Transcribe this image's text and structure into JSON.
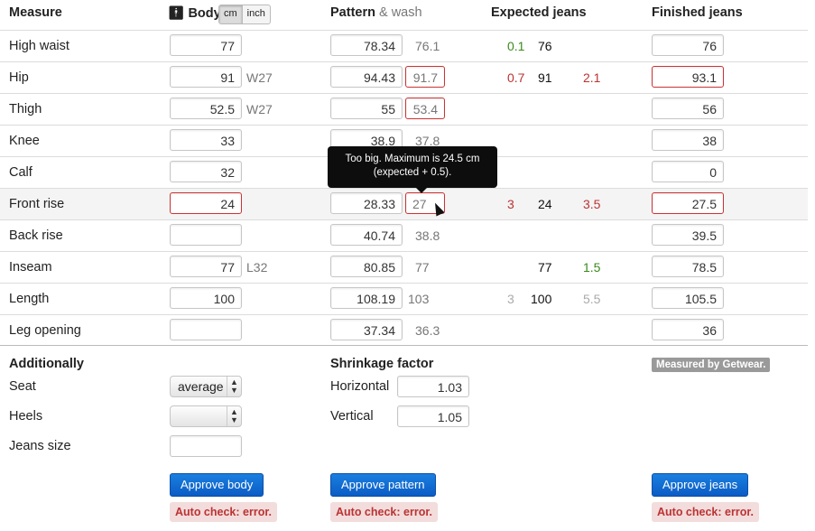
{
  "headers": {
    "measure": "Measure",
    "body": "Body",
    "unit_cm": "cm",
    "unit_inch": "inch",
    "pattern": "Pattern",
    "pattern_suffix": "& wash",
    "expected": "Expected jeans",
    "finished": "Finished jeans"
  },
  "rows": [
    {
      "label": "High waist",
      "body": "77",
      "body_note": "",
      "pattern": "78.34",
      "pattern_calc": "76.1",
      "exp_a": "0.1",
      "exp_b": "76",
      "exp_c": "",
      "finished": "76"
    },
    {
      "label": "Hip",
      "body": "91",
      "body_note": "W27",
      "pattern": "94.43",
      "pattern_calc": "91.7",
      "exp_a": "0.7",
      "exp_b": "91",
      "exp_c": "2.1",
      "finished": "93.1"
    },
    {
      "label": "Thigh",
      "body": "52.5",
      "body_note": "W27",
      "pattern": "55",
      "pattern_calc": "53.4",
      "exp_a": "",
      "exp_b": "",
      "exp_c": "",
      "finished": "56"
    },
    {
      "label": "Knee",
      "body": "33",
      "body_note": "",
      "pattern": "38.9",
      "pattern_calc": "37.8",
      "exp_a": "",
      "exp_b": "",
      "exp_c": "",
      "finished": "38"
    },
    {
      "label": "Calf",
      "body": "32",
      "body_note": "",
      "pattern": "",
      "pattern_calc": "",
      "exp_a": "",
      "exp_b": "",
      "exp_c": "",
      "finished": "0"
    },
    {
      "label": "Front rise",
      "body": "24",
      "body_note": "",
      "pattern": "28.33",
      "pattern_calc": "27",
      "exp_a": "3",
      "exp_b": "24",
      "exp_c": "3.5",
      "finished": "27.5"
    },
    {
      "label": "Back rise",
      "body": "",
      "body_note": "",
      "pattern": "40.74",
      "pattern_calc": "38.8",
      "exp_a": "",
      "exp_b": "",
      "exp_c": "",
      "finished": "39.5"
    },
    {
      "label": "Inseam",
      "body": "77",
      "body_note": "L32",
      "pattern": "80.85",
      "pattern_calc": "77",
      "exp_a": "",
      "exp_b": "77",
      "exp_c": "1.5",
      "finished": "78.5"
    },
    {
      "label": "Length",
      "body": "100",
      "body_note": "",
      "pattern": "108.19",
      "pattern_calc": "103",
      "exp_a": "3",
      "exp_b": "100",
      "exp_c": "5.5",
      "finished": "105.5"
    },
    {
      "label": "Leg opening",
      "body": "",
      "body_note": "",
      "pattern": "37.34",
      "pattern_calc": "36.3",
      "exp_a": "",
      "exp_b": "",
      "exp_c": "",
      "finished": "36"
    }
  ],
  "tooltip": "Too big. Maximum is 24.5 cm (expected + 0.5).",
  "additionally": {
    "title": "Additionally",
    "seat_label": "Seat",
    "seat_value": "average",
    "heels_label": "Heels",
    "heels_value": "",
    "jeans_size_label": "Jeans size",
    "jeans_size_value": ""
  },
  "shrinkage": {
    "title": "Shrinkage factor",
    "horizontal_label": "Horizontal",
    "horizontal_value": "1.03",
    "vertical_label": "Vertical",
    "vertical_value": "1.05"
  },
  "badge": "Measured by Getwear.",
  "buttons": {
    "approve_body": "Approve body",
    "approve_pattern": "Approve pattern",
    "approve_jeans": "Approve jeans"
  },
  "auto_check": "Auto check: error.",
  "colors": {
    "error": "#b33333",
    "ok": "#3a8a1c",
    "button": "#0b5cc4"
  }
}
